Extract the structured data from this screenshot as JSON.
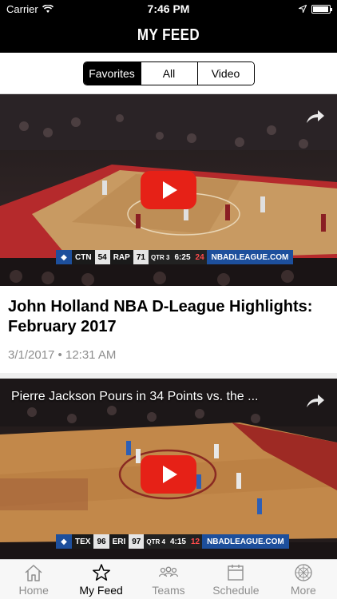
{
  "status_bar": {
    "carrier": "Carrier",
    "time": "7:46 PM",
    "battery_level": 0.95
  },
  "nav": {
    "title": "MY FEED"
  },
  "segments": [
    {
      "label": "Favorites",
      "active": true
    },
    {
      "label": "All",
      "active": false
    },
    {
      "label": "Video",
      "active": false
    }
  ],
  "feed": {
    "items": [
      {
        "title": "John Holland NBA D-League Highlights: February 2017",
        "date": "3/1/2017 • 12:31 AM",
        "overlay_title": "",
        "scorebug": {
          "team1": "CTN",
          "score1": "54",
          "team2": "RAP",
          "score2": "71",
          "quarter": "QTR 3",
          "clock": "6:25",
          "shot_clock": "24",
          "site": "NBADLEAGUE.COM"
        }
      },
      {
        "title": "",
        "date": "",
        "overlay_title": "Pierre Jackson Pours in 34 Points vs. the ...",
        "scorebug": {
          "team1": "TEX",
          "score1": "96",
          "team2": "ERI",
          "score2": "97",
          "quarter": "QTR 4",
          "clock": "4:15",
          "shot_clock": "12",
          "site": "NBADLEAGUE.COM"
        }
      }
    ]
  },
  "tabs": [
    {
      "label": "Home",
      "icon": "home-icon",
      "active": false
    },
    {
      "label": "My Feed",
      "icon": "star-icon",
      "active": true
    },
    {
      "label": "Teams",
      "icon": "teams-icon",
      "active": false
    },
    {
      "label": "Schedule",
      "icon": "calendar-icon",
      "active": false
    },
    {
      "label": "More",
      "icon": "more-icon",
      "active": false
    }
  ],
  "colors": {
    "play_button": "#e62117",
    "accent_blue": "#1d4f9c"
  }
}
